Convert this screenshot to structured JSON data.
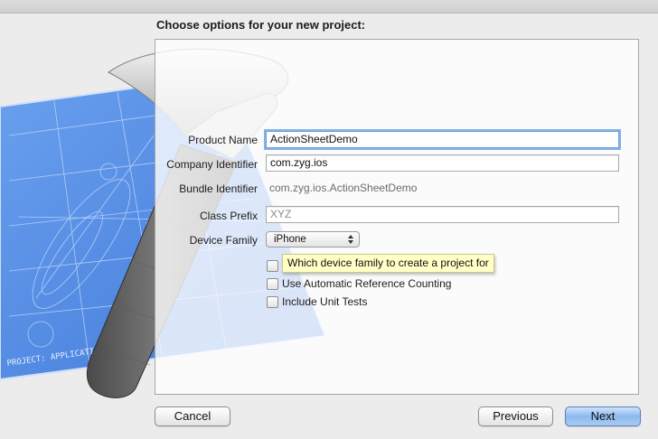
{
  "dialog": {
    "title": "Choose options for your new project:"
  },
  "form": {
    "product_name": {
      "label": "Product Name",
      "value": "ActionSheetDemo"
    },
    "company_identifier": {
      "label": "Company Identifier",
      "value": "com.zyg.ios"
    },
    "bundle_identifier": {
      "label": "Bundle Identifier",
      "value": "com.zyg.ios.ActionSheetDemo"
    },
    "class_prefix": {
      "label": "Class Prefix",
      "placeholder": "XYZ"
    },
    "device_family": {
      "label": "Device Family",
      "selected": "iPhone"
    },
    "checkboxes": [
      {
        "label": "",
        "checked": false
      },
      {
        "label": "Use Automatic Reference Counting",
        "checked": false
      },
      {
        "label": "Include Unit Tests",
        "checked": false
      }
    ]
  },
  "tooltip": {
    "text": "Which device family to create a project for"
  },
  "buttons": {
    "cancel": "Cancel",
    "previous": "Previous",
    "next": "Next"
  },
  "illustration": {
    "blueprint_text": "PROJECT: APPLICATION.APP",
    "icons": [
      "hammer-icon",
      "blueprint-icon"
    ]
  },
  "colors": {
    "blueprint": "#5b8fe6",
    "focus_ring": "#86b2e4",
    "tooltip_bg": "#ffffc6",
    "primary_button": "#8db9ee"
  }
}
